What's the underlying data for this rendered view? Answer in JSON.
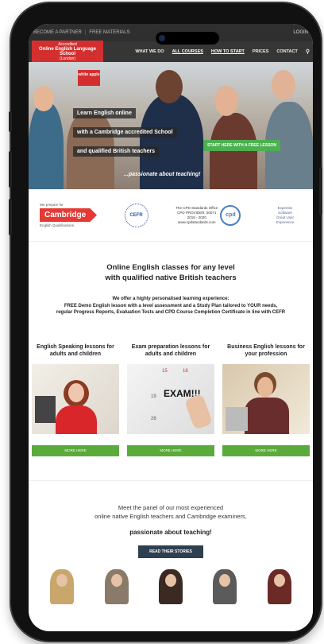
{
  "topbar": {
    "links": [
      "BECOME A PARTNER",
      "FREE MATERIALS"
    ],
    "login": "LOGIN"
  },
  "logo": {
    "line1": "Accredited",
    "line2": "Online English Language School",
    "line3": "(London)"
  },
  "nav": {
    "items": [
      "WHAT WE DO",
      "ALL COURSES",
      "HOW TO START",
      "PRICES",
      "CONTACT"
    ]
  },
  "hero": {
    "badge": "white apple",
    "lines": [
      "Learn English online",
      "with a Cambridge accredited School",
      "and qualified British teachers"
    ],
    "cta": "START HERE WITH A FREE LESSON",
    "tagline": "...passionate about teaching!"
  },
  "logos": {
    "cambridge_prep": "We prepare for",
    "cambridge": "Cambridge",
    "cambridge_sub": "English Qualifications",
    "cefr": "CEFR",
    "cpd_line1": "The CPD Standards Office",
    "cpd_line2": "CPD PROVIDER: 50071",
    "cpd_line3": "2018 - 2020",
    "cpd_line4": "www.cpdstandards.com",
    "cpd_badge": "cpd",
    "award_line1": "Expertise",
    "award_line2": "Software",
    "award_line3": "Great User Experience"
  },
  "intro": {
    "heading_1": "Online English classes for any level",
    "heading_2": "with qualified native British teachers",
    "lead_1": "We offer a highly personalised learning experience:",
    "lead_2": "FREE Demo English lesson with a level assessment and a Study Plan tailored to YOUR needs,",
    "lead_3": "regular Progress Reports, Evaluation Tests and CPD Course Completion Certificate in line with CEFR"
  },
  "courses": [
    {
      "title": "English Speaking lessons for adults and children",
      "more": "MORE HERE"
    },
    {
      "title": "Exam preparation lessons for adults and children",
      "more": "MORE HERE",
      "image_text": "EXAM!!!"
    },
    {
      "title": "Business English lessons for your profession",
      "more": "MORE HERE"
    }
  ],
  "teachers": {
    "line1": "Meet the panel of our most experienced",
    "line2": "online native English teachers and Cambridge examiners,",
    "line3": "passionate about teaching!",
    "button": "READ THEIR STORIES"
  },
  "colors": {
    "brand_red": "#d32f2f",
    "green": "#5aaa3c",
    "dark_nav": "#363636",
    "button_dark": "#2e4050"
  }
}
